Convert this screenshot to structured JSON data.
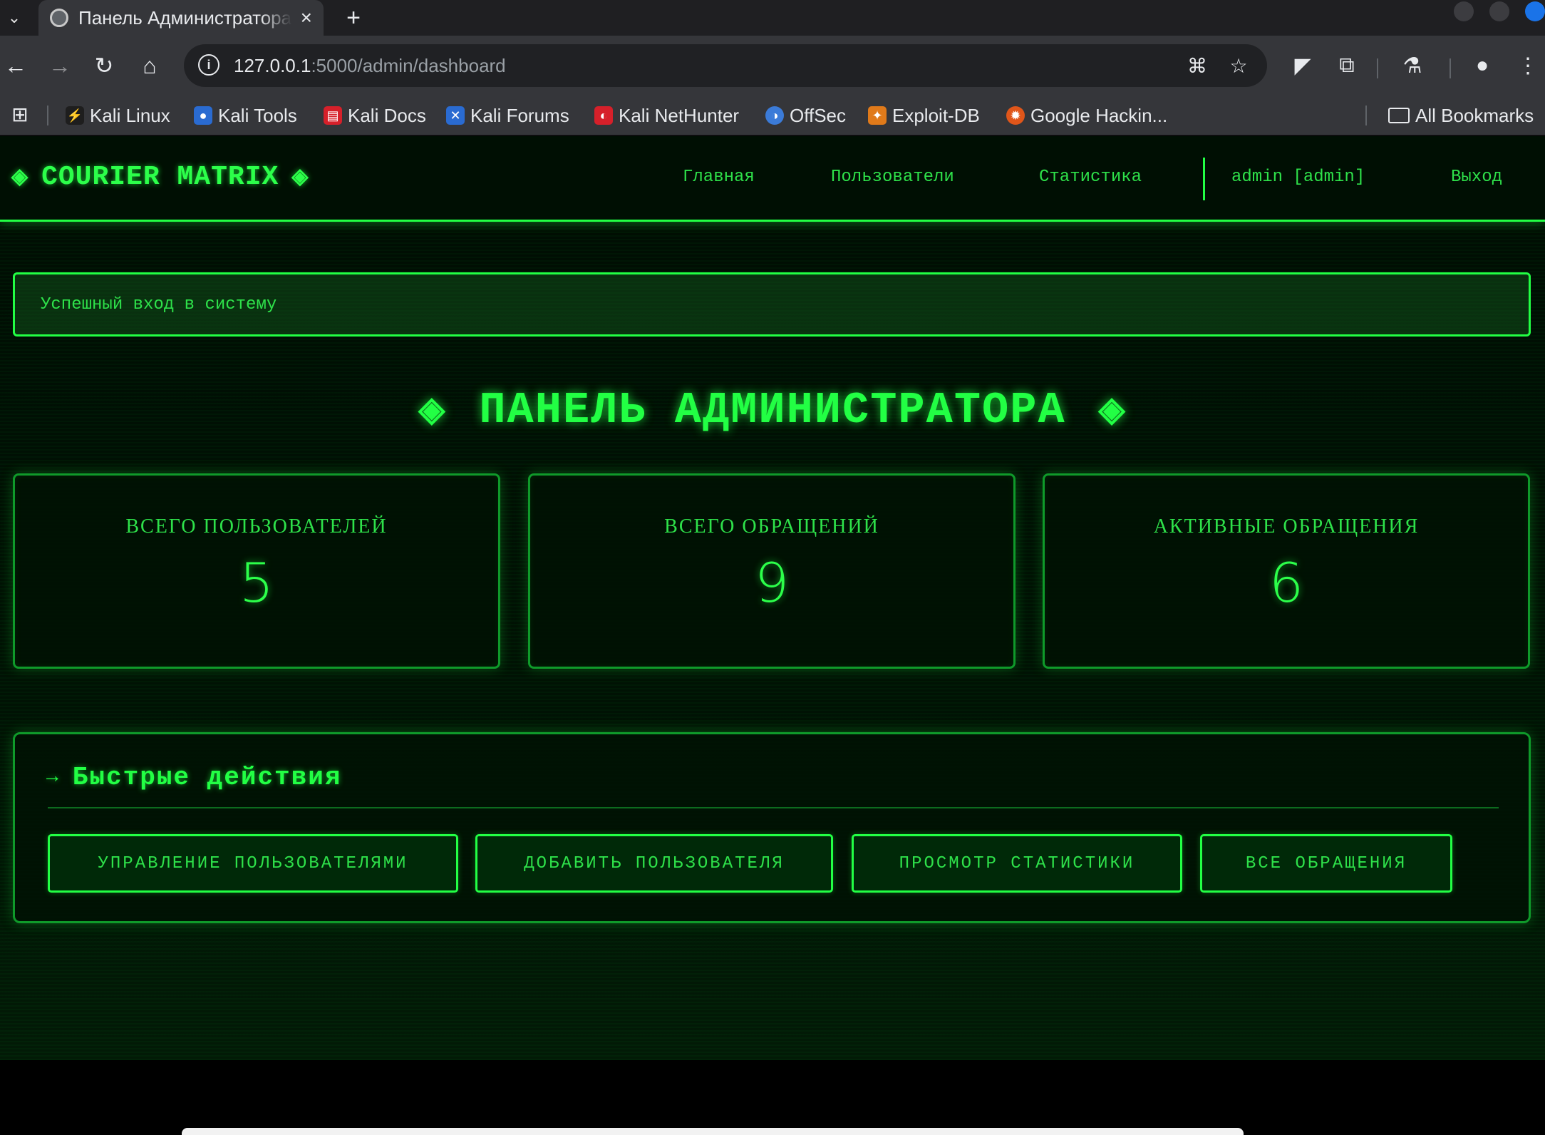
{
  "browser": {
    "tab_title": "Панель Администратора",
    "tab_close": "×",
    "new_tab": "+",
    "url_host": "127.0.0.1",
    "url_path": ":5000/admin/dashboard",
    "bookmarks": [
      {
        "label": "Kali Linux",
        "color": "#1e1e1e"
      },
      {
        "label": "Kali Tools",
        "color": "#2a6bd1"
      },
      {
        "label": "Kali Docs",
        "color": "#d6202a"
      },
      {
        "label": "Kali Forums",
        "color": "#2a6bd1"
      },
      {
        "label": "Kali NetHunter",
        "color": "#d6202a"
      },
      {
        "label": "OffSec",
        "color": "#3b7bd8"
      },
      {
        "label": "Exploit-DB",
        "color": "#e07a1a"
      },
      {
        "label": "Google Hackin...",
        "color": "#e0561a"
      }
    ],
    "all_bookmarks": "All Bookmarks"
  },
  "site": {
    "logo": "COURIER MATRIX",
    "diamond": "◈",
    "nav": {
      "home": "Главная",
      "users": "Пользователи",
      "stats": "Статистика",
      "user": "admin [admin]",
      "logout": "Выход"
    },
    "flash": "Успешный вход в систему",
    "title": "ПАНЕЛЬ АДМИНИСТРАТОРА",
    "stats": [
      {
        "label": "ВСЕГО ПОЛЬЗОВАТЕЛЕЙ",
        "value": "5"
      },
      {
        "label": "ВСЕГО ОБРАЩЕНИЙ",
        "value": "9"
      },
      {
        "label": "АКТИВНЫЕ ОБРАЩЕНИЯ",
        "value": "6"
      }
    ],
    "quick": {
      "arrow": "→",
      "title": "Быстрые действия",
      "buttons": [
        "УПРАВЛЕНИЕ ПОЛЬЗОВАТЕЛЯМИ",
        "ДОБАВИТЬ ПОЛЬЗОВАТЕЛЯ",
        "ПРОСМОТР СТАТИСТИКИ",
        "ВСЕ ОБРАЩЕНИЯ"
      ]
    }
  },
  "colors": {
    "accent": "#22ff44",
    "background": "#000d03"
  }
}
